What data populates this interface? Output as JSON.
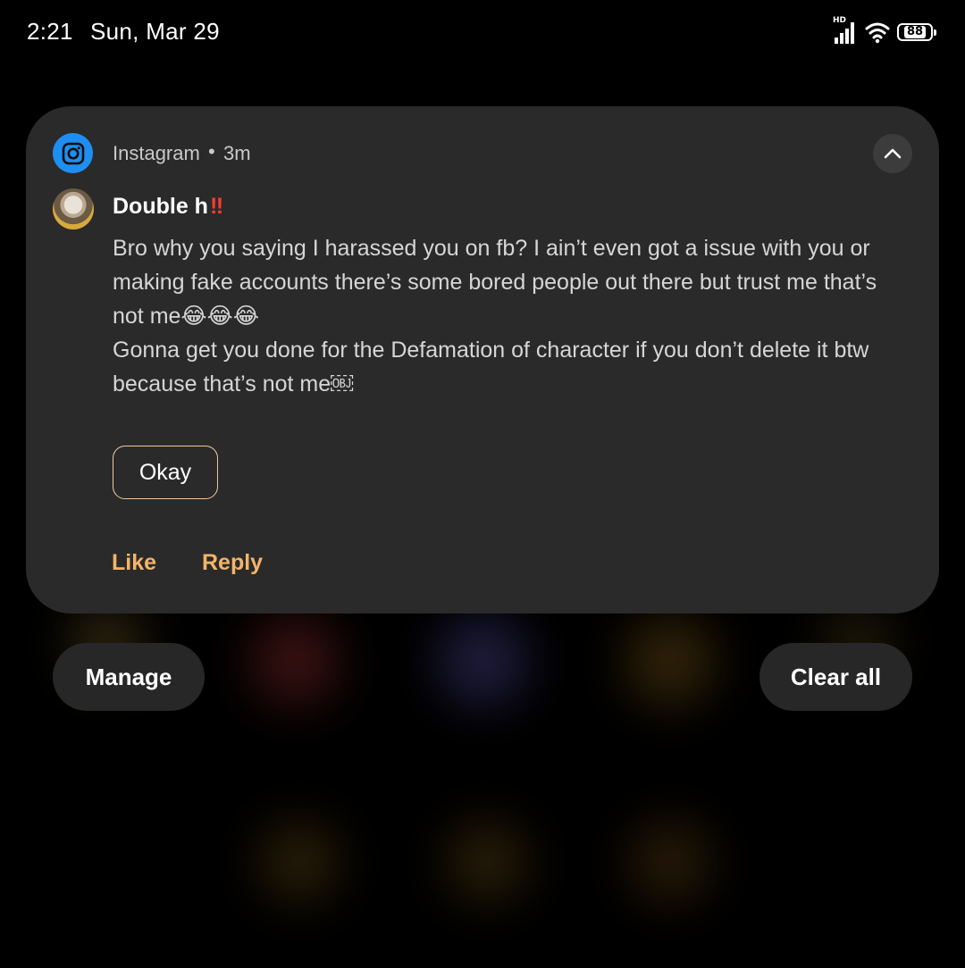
{
  "status_bar": {
    "time": "2:21",
    "date": "Sun, Mar 29",
    "network_label": "HD",
    "battery": "88",
    "icons": [
      "signal-icon",
      "wifi-icon",
      "battery-icon"
    ]
  },
  "notification": {
    "app_name": "Instagram",
    "separator": "•",
    "time_ago": "3m",
    "sender": "Double h",
    "sender_suffix": "‼",
    "message": "Bro why you saying I harassed you on fb? I ain’t even got a issue with you or making fake accounts there’s some bored people out there but trust me that’s not me😂😂😂\nGonna get you done for the Defamation of character if you don’t delete it btw because that’s not me￼",
    "quick_reply": "Okay",
    "actions": {
      "like": "Like",
      "reply": "Reply"
    },
    "accent_color": "#f4b46a",
    "app_icon": "instagram-icon",
    "app_icon_color": "#1f8ef1"
  },
  "bottom_buttons": {
    "manage": "Manage",
    "clear_all": "Clear all"
  }
}
